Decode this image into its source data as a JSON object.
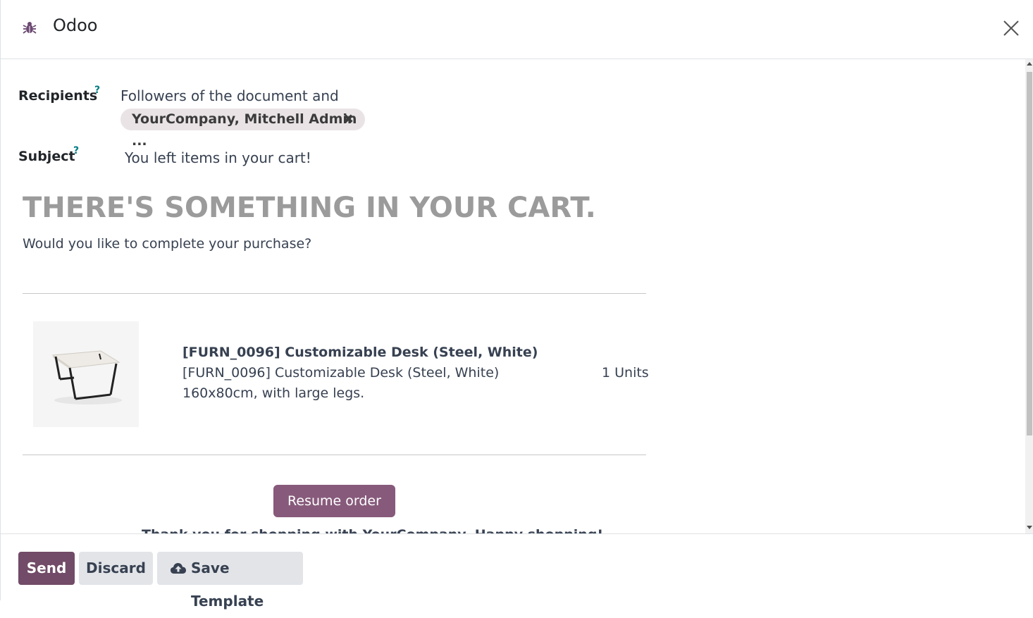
{
  "header": {
    "title": "Odoo",
    "icon": "bug-icon",
    "close_icon": "close-icon"
  },
  "form": {
    "recipients_label": "Recipients",
    "recipients_help": "?",
    "recipients_text": "Followers of the document and",
    "recipient_tag": "YourCompany, Mitchell Admin ...",
    "recipient_tag_remove": "✖",
    "subject_label": "Subject",
    "subject_help": "?",
    "subject_value": "You left items in your cart!"
  },
  "email_body": {
    "heading": "THERE'S SOMETHING IN YOUR CART.",
    "subheading": "Would you like to complete your purchase?",
    "product": {
      "name": "[FURN_0096] Customizable Desk (Steel, White)",
      "description_line1": "[FURN_0096] Customizable Desk (Steel, White)",
      "description_line2": "160x80cm, with large legs.",
      "quantity": "1 Units"
    },
    "resume_button": "Resume order",
    "cut_off_text": "Thank you for shopping with YourCompany. Happy shopping!"
  },
  "footer": {
    "send_label": "Send",
    "discard_label": "Discard",
    "save_template_label": "Save Template"
  },
  "colors": {
    "primary": "#714b67",
    "accent": "#875a7b",
    "help": "#017e84"
  }
}
